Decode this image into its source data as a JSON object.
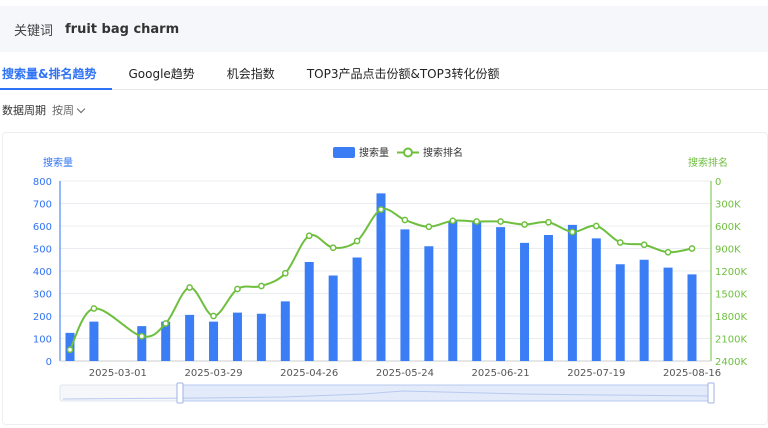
{
  "keyword_bar": {
    "label": "关键词",
    "value": "fruit bag charm"
  },
  "tabs": [
    {
      "label": "搜索量&排名趋势",
      "active": true
    },
    {
      "label": "Google趋势",
      "active": false
    },
    {
      "label": "机会指数",
      "active": false
    },
    {
      "label": "TOP3产品点击份额&TOP3转化份额",
      "active": false
    }
  ],
  "period": {
    "label": "数据周期",
    "value": "按周"
  },
  "colors": {
    "accent": "#2f73f6",
    "bar": "#3b7df5",
    "rank_line": "#6fbf3f",
    "axis_left": "#2f73f6",
    "axis_right": "#6fbf3f"
  },
  "chart_data": {
    "type": "bar",
    "legend": [
      "搜索量",
      "搜索排名"
    ],
    "legend_position": "top-center",
    "left_axis": {
      "name": "搜索量",
      "ticks": [
        "0",
        "100",
        "200",
        "300",
        "400",
        "500",
        "600",
        "700",
        "800"
      ],
      "range": [
        0,
        800
      ]
    },
    "right_axis": {
      "name": "搜索排名",
      "ticks": [
        "0",
        "300K",
        "600K",
        "900K",
        "1200K",
        "1500K",
        "1800K",
        "2100K",
        "2400K"
      ],
      "range": [
        0,
        2400000
      ],
      "inverted": true
    },
    "x_labels": [
      "2025-03-01",
      "2025-03-29",
      "2025-04-26",
      "2025-05-24",
      "2025-06-21",
      "2025-07-19",
      "2025-08-16"
    ],
    "x": [
      "2025-02-15",
      "2025-02-22",
      "2025-03-01",
      "2025-03-08",
      "2025-03-15",
      "2025-03-22",
      "2025-03-29",
      "2025-04-05",
      "2025-04-12",
      "2025-04-19",
      "2025-04-26",
      "2025-05-03",
      "2025-05-10",
      "2025-05-17",
      "2025-05-24",
      "2025-05-31",
      "2025-06-07",
      "2025-06-14",
      "2025-06-21",
      "2025-06-28",
      "2025-07-05",
      "2025-07-12",
      "2025-07-19",
      "2025-07-26",
      "2025-08-02",
      "2025-08-09",
      "2025-08-16"
    ],
    "series": [
      {
        "name": "搜索量",
        "type": "bar",
        "values": [
          125,
          175,
          null,
          155,
          175,
          205,
          175,
          215,
          210,
          265,
          440,
          380,
          460,
          745,
          585,
          510,
          620,
          620,
          595,
          525,
          560,
          605,
          545,
          430,
          450,
          415,
          385
        ]
      },
      {
        "name": "搜索排名",
        "type": "line",
        "values": [
          2250000,
          1700000,
          null,
          2070000,
          1900000,
          1420000,
          1800000,
          1440000,
          1400000,
          1230000,
          730000,
          890000,
          800000,
          380000,
          520000,
          610000,
          530000,
          540000,
          540000,
          580000,
          550000,
          680000,
          600000,
          820000,
          850000,
          950000,
          900000
        ]
      }
    ],
    "grid": true,
    "has_zoom_slider": true
  }
}
